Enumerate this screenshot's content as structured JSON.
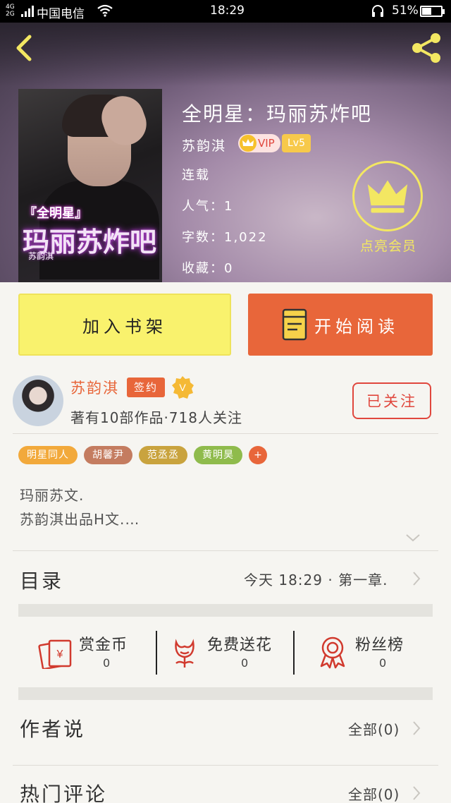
{
  "status_bar": {
    "network_top": "4G",
    "network_bottom": "2G",
    "carrier": "中国电信",
    "time": "18:29",
    "battery": "51%",
    "battery_level": 0.51
  },
  "book": {
    "title": "全明星：玛丽苏炸吧",
    "author": "苏韵淇",
    "vip_label": "VIP",
    "level_label": "Lv5",
    "status": "连载",
    "popularity": "人气：1",
    "word_count": "字数：1,022",
    "favorites": "收藏：0",
    "member_label": "点亮会员",
    "cover_text_line1": "『全明星』",
    "cover_text_line2": "玛丽苏炸吧",
    "cover_text_line3": "苏韵淇"
  },
  "actions": {
    "add_shelf": "加入书架",
    "start_reading": "开始阅读"
  },
  "author_card": {
    "name": "苏韵淇",
    "signed_badge": "签约",
    "verified_label": "V",
    "stats": "著有10部作品·718人关注",
    "follow_label": "已关注"
  },
  "tags": [
    {
      "label": "明星同人",
      "color": "#f2a93b"
    },
    {
      "label": "胡馨尹",
      "color": "#c47c60"
    },
    {
      "label": "范丞丞",
      "color": "#c9a33e"
    },
    {
      "label": "黄明昊",
      "color": "#8fbb4c"
    }
  ],
  "tag_more": "+",
  "description": {
    "line1": "玛丽苏文.",
    "line2": "苏韵淇出品H文.…"
  },
  "catalog": {
    "label": "目录",
    "latest": "今天 18:29 · 第一章."
  },
  "rewards": [
    {
      "label": "赏金币",
      "count": "0",
      "icon": "red-envelope-icon"
    },
    {
      "label": "免费送花",
      "count": "0",
      "icon": "flower-icon"
    },
    {
      "label": "粉丝榜",
      "count": "0",
      "icon": "medal-icon"
    }
  ],
  "author_says": {
    "label": "作者说",
    "all": "全部(0)"
  },
  "hot_comments": {
    "label": "热门评论",
    "all": "全部(0)"
  },
  "colors": {
    "accent_orange": "#e8663a",
    "shelf_yellow": "#f9f26d",
    "member_yellow": "#f3e762",
    "follow_red": "#e0473d"
  }
}
